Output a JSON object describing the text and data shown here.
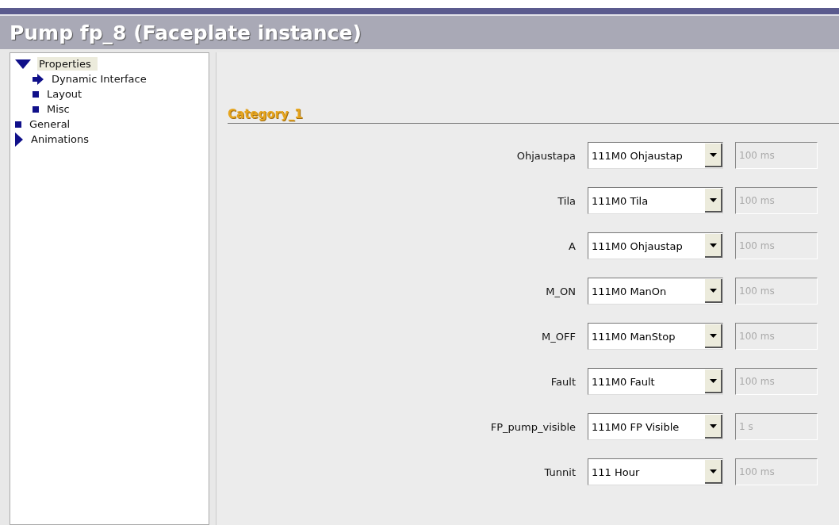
{
  "window": {
    "title": "Pump fp_8 (Faceplate instance)"
  },
  "tree": [
    {
      "kind": "group",
      "label": "Properties",
      "expanded": true,
      "selected": true,
      "children": [
        {
          "kind": "leaf",
          "label": "Dynamic Interface",
          "active": true,
          "selected": false
        },
        {
          "kind": "leaf",
          "label": "Layout",
          "active": false,
          "selected": false
        },
        {
          "kind": "leaf",
          "label": "Misc",
          "active": false,
          "selected": false
        }
      ]
    },
    {
      "kind": "leaf",
      "label": "General",
      "active": false,
      "selected": false
    },
    {
      "kind": "group",
      "label": "Animations",
      "expanded": false,
      "selected": false
    }
  ],
  "category": {
    "title": "Category_1"
  },
  "rows": [
    {
      "label": "Ohjaustapa",
      "tag": "111M0 Ohjaustap",
      "cycle": "100 ms"
    },
    {
      "label": "Tila",
      "tag": "111M0 Tila",
      "cycle": "100 ms"
    },
    {
      "label": "A",
      "tag": "111M0 Ohjaustap",
      "cycle": "100 ms"
    },
    {
      "label": "M_ON",
      "tag": "111M0 ManOn",
      "cycle": "100 ms"
    },
    {
      "label": "M_OFF",
      "tag": "111M0 ManStop",
      "cycle": "100 ms"
    },
    {
      "label": "Fault",
      "tag": "111M0 Fault",
      "cycle": "100 ms"
    },
    {
      "label": "FP_pump_visible",
      "tag": "111M0 FP Visible",
      "cycle": "1 s"
    },
    {
      "label": "Tunnit",
      "tag": "111 Hour",
      "cycle": "100 ms"
    }
  ]
}
